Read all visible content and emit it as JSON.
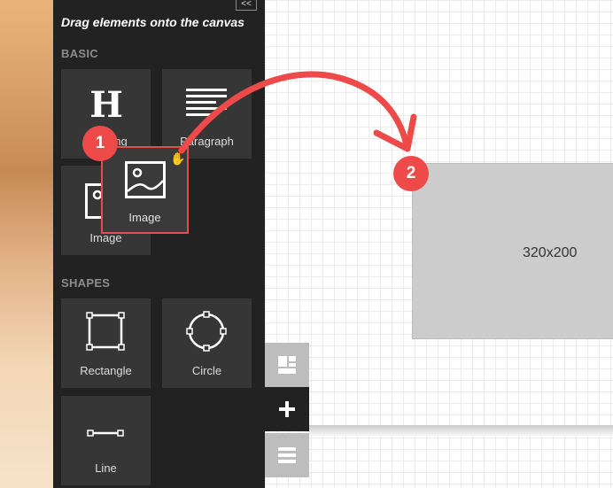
{
  "panel": {
    "collapse_label": "<<",
    "title": "Drag elements onto the canvas",
    "sections": {
      "basic": "BASIC",
      "shapes": "SHAPES"
    },
    "basic_items": [
      {
        "label": "Heading",
        "icon": "heading-icon"
      },
      {
        "label": "Paragraph",
        "icon": "paragraph-icon"
      },
      {
        "label": "Image",
        "icon": "image-icon"
      }
    ],
    "shape_items": [
      {
        "label": "Rectangle",
        "icon": "rectangle-shape-icon"
      },
      {
        "label": "Circle",
        "icon": "circle-shape-icon"
      },
      {
        "label": "Line",
        "icon": "line-shape-icon"
      }
    ]
  },
  "drag_ghost": {
    "label": "Image",
    "icon": "image-icon"
  },
  "steps": [
    "1",
    "2"
  ],
  "canvas": {
    "placeholder_label": "320x200"
  },
  "side_toolbar": [
    {
      "name": "layout-icon",
      "bg": "#bdbdbd"
    },
    {
      "name": "add-icon",
      "bg": "#222222"
    },
    {
      "name": "menu-icon",
      "bg": "#bdbdbd"
    }
  ],
  "colors": {
    "panel_bg": "#222222",
    "tile_bg": "#363636",
    "accent_red": "#ef4a4a",
    "placeholder_bg": "#cccccc"
  }
}
